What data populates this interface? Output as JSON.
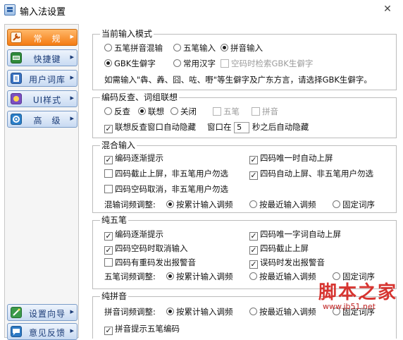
{
  "window": {
    "title": "输入法设置",
    "close_glyph": "✕"
  },
  "sidebar": {
    "top_items": [
      {
        "label": "常　规",
        "icon": "wrench-icon"
      },
      {
        "label": "快捷键",
        "icon": "keyboard-icon"
      },
      {
        "label": "用户词库",
        "icon": "book-icon"
      },
      {
        "label": "UI样式",
        "icon": "palette-icon"
      },
      {
        "label": "高　级",
        "icon": "gear-icon"
      }
    ],
    "bottom_items": [
      {
        "label": "设置向导",
        "icon": "wand-icon"
      },
      {
        "label": "意见反馈",
        "icon": "feedback-icon"
      }
    ],
    "active_index": 0,
    "colors": {
      "active": "#f47b12",
      "normal": "#c8daf2"
    }
  },
  "sections": {
    "mode": {
      "title": "当前输入模式",
      "options": [
        "五笔拼音混输",
        "五笔输入",
        "拼音输入"
      ],
      "selected": "拼音输入",
      "charset_options": [
        "GBK生僻字",
        "常用汉字"
      ],
      "charset_selected": "GBK生僻字",
      "gbk_search_label": "空码时检索GBK生僻字",
      "gbk_search_checked": false,
      "hint": "如需输入\"犇、羴、囧、咗、嘢\"等生僻字及广东方言，请选择GBK生僻字。"
    },
    "reverse": {
      "title": "编码反查、词组联想",
      "options": [
        "反查",
        "联想",
        "关闭"
      ],
      "selected": "联想",
      "wubi_label": "五笔",
      "pinyin_label": "拼音",
      "autohide_label": "联想反查窗口自动隐藏",
      "autohide_checked": true,
      "window_prefix": "窗口在",
      "window_seconds": "5",
      "window_suffix": "秒之后自动隐藏"
    },
    "mixed": {
      "title": "混合输入",
      "checks": [
        {
          "label": "编码逐渐提示",
          "checked": true
        },
        {
          "label": "四码唯一时自动上屏",
          "checked": true
        },
        {
          "label": "四码截止上屏，非五笔用户勿选",
          "checked": false
        },
        {
          "label": "四码自动上屏、非五笔用户勿选",
          "checked": true
        },
        {
          "label": "四码空码取消，非五笔用户勿选",
          "checked": false
        }
      ],
      "freq_label": "混输词频调整:",
      "freq_options": [
        "按累计输入调频",
        "按最近输入调频",
        "固定词序"
      ],
      "freq_selected": "按累计输入调频"
    },
    "wubi": {
      "title": "纯五笔",
      "checks": [
        {
          "label": "编码逐渐提示",
          "checked": true
        },
        {
          "label": "四码唯一字词自动上屏",
          "checked": true
        },
        {
          "label": "四码空码时取消输入",
          "checked": true
        },
        {
          "label": "四码截止上屏",
          "checked": true
        },
        {
          "label": "四码有重码发出报警音",
          "checked": false
        },
        {
          "label": "误码时发出报警音",
          "checked": true
        }
      ],
      "freq_label": "五笔词频调整:",
      "freq_options": [
        "按累计输入调频",
        "按最近输入调频",
        "固定词序"
      ],
      "freq_selected": "按累计输入调频"
    },
    "pinyin": {
      "title": "纯拼音",
      "freq_label": "拼音词频调整:",
      "freq_options": [
        "按累计输入调频",
        "按最近输入调频",
        "固定词序"
      ],
      "freq_selected": "按累计输入调频",
      "hint_wubi_label": "拼音提示五笔编码",
      "hint_wubi_checked": true
    }
  },
  "watermark": {
    "text": "脚本之家",
    "url": "www.jb51.net"
  }
}
